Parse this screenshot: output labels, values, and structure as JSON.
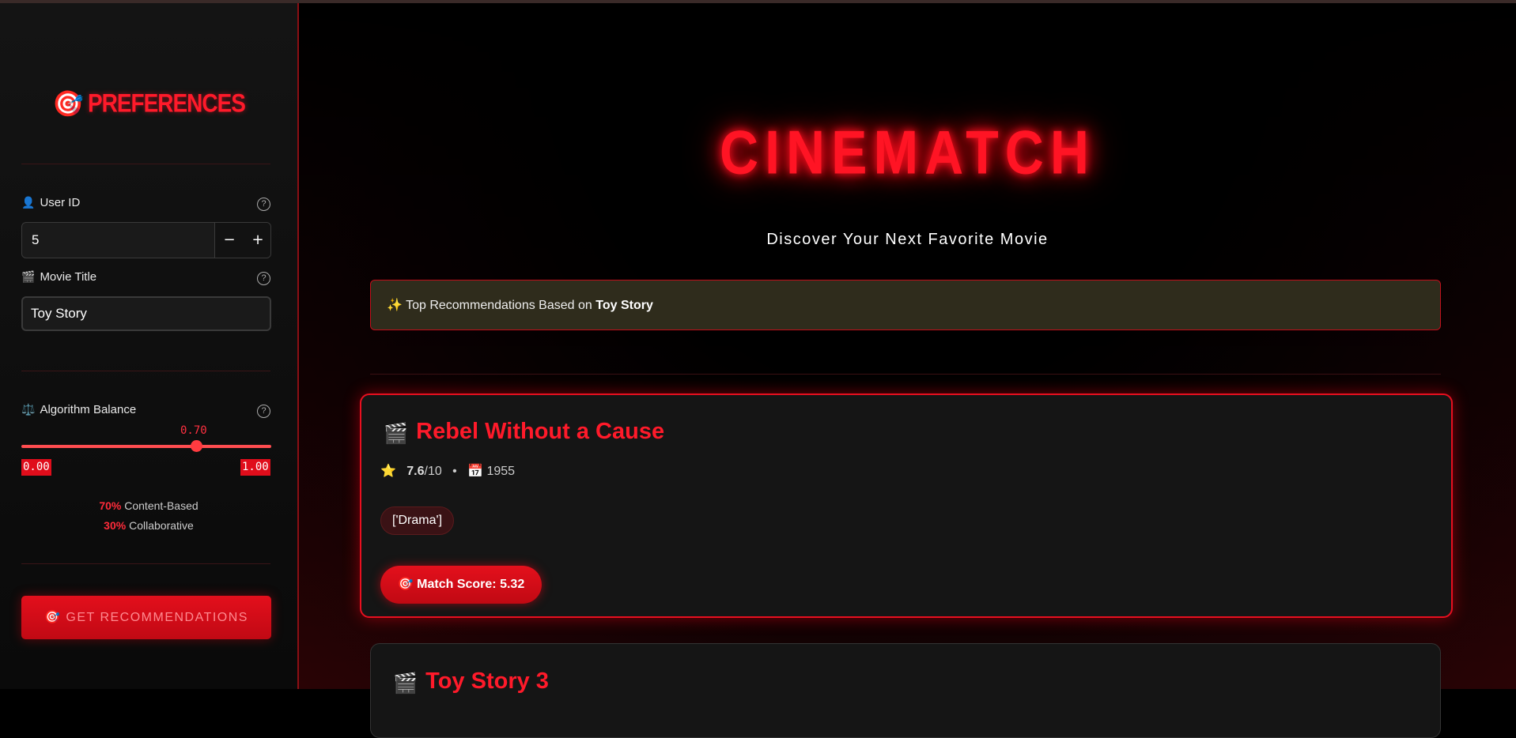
{
  "sidebar": {
    "title": "PREFERENCES",
    "user_id": {
      "label": "User ID",
      "value": "5",
      "minus": "−",
      "plus": "+"
    },
    "movie_title": {
      "label": "Movie Title",
      "value": "Toy Story"
    },
    "algorithm_balance": {
      "label": "Algorithm Balance",
      "value": 0.7,
      "value_text": "0.70",
      "min_text": "0.00",
      "max_text": "1.00",
      "content_pct": "70%",
      "content_label": "Content-Based",
      "collab_pct": "30%",
      "collab_label": "Collaborative"
    },
    "button_label": "GET RECOMMENDATIONS",
    "help_symbol": "?"
  },
  "main": {
    "brand": "CINEMATCH",
    "tagline": "Discover Your Next Favorite Movie",
    "banner_prefix": "Top Recommendations Based on",
    "banner_movie": "Toy Story",
    "cards": [
      {
        "title": "Rebel Without a Cause",
        "rating": "7.6",
        "rating_suffix": "/10",
        "separator": "•",
        "year": "1955",
        "genre": "['Drama']",
        "match_score": "Match Score: 5.32"
      },
      {
        "title": "Toy Story 3"
      }
    ]
  },
  "icons": {
    "target": "target-icon",
    "user": "user-icon",
    "clapper": "clapper-icon",
    "scales": "scales-icon",
    "sparkles": "sparkles-icon",
    "star": "star-icon",
    "calendar": "calendar-icon"
  },
  "colors": {
    "accent": "#ff1a2a",
    "button": "#e30f1c",
    "banner_bg": "#2f2c1c"
  }
}
